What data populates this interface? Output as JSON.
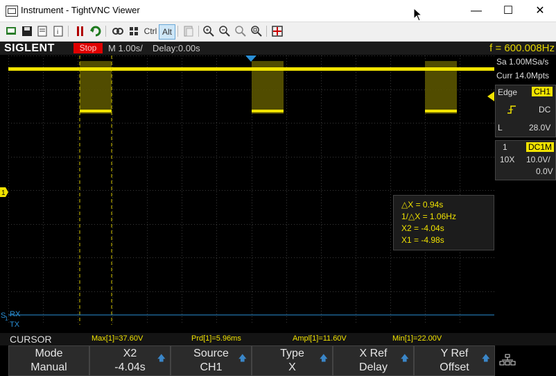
{
  "window": {
    "title": "Instrument - TightVNC Viewer"
  },
  "toolbar": {
    "ctrl_label": "Ctrl",
    "alt_label": "Alt"
  },
  "scope": {
    "brand": "SIGLENT",
    "status": "Stop",
    "timebase": "M 1.00s/",
    "delay": "Delay:0.00s",
    "frequency": "f = 600.008Hz",
    "acq": {
      "sample_rate": "Sa 1.00MSa/s",
      "memory": "Curr 14.0Mpts"
    },
    "trigger": {
      "type_label": "Edge",
      "source": "CH1",
      "coupling": "DC",
      "level_label": "L",
      "level": "28.0V"
    },
    "channel": {
      "number": "1",
      "coupling": "DC1M",
      "probe": "10X",
      "scale": "10.0V/",
      "offset": "0.0V"
    },
    "measurements": {
      "delta_x": "△X = 0.94s",
      "inv_delta_x": "1/△X = 1.06Hz",
      "x2": "X2 = -4.04s",
      "x1": "X1 = -4.98s"
    },
    "serial": {
      "label_s": "S",
      "label_1": "1",
      "rx": "RX",
      "tx": "TX"
    },
    "cursor_bar": {
      "title": "CURSOR",
      "max": "Max[1]=37.60V",
      "prd": "Prd[1]=5.96ms",
      "ampl": "Ampl[1]=11.60V",
      "min": "Min[1]=22.00V"
    },
    "softkeys": [
      {
        "label": "Mode",
        "value": "Manual",
        "arrow": false
      },
      {
        "label": "X2",
        "value": "-4.04s",
        "arrow": true
      },
      {
        "label": "Source",
        "value": "CH1",
        "arrow": true
      },
      {
        "label": "Type",
        "value": "X",
        "arrow": true
      },
      {
        "label": "X Ref",
        "value": "Delay",
        "arrow": true
      },
      {
        "label": "Y Ref",
        "value": "Offset",
        "arrow": true
      }
    ],
    "ch1_marker": "1",
    "colors": {
      "trace": "#f0e200",
      "serial": "#2a8fd6",
      "stop": "#e00000"
    }
  }
}
